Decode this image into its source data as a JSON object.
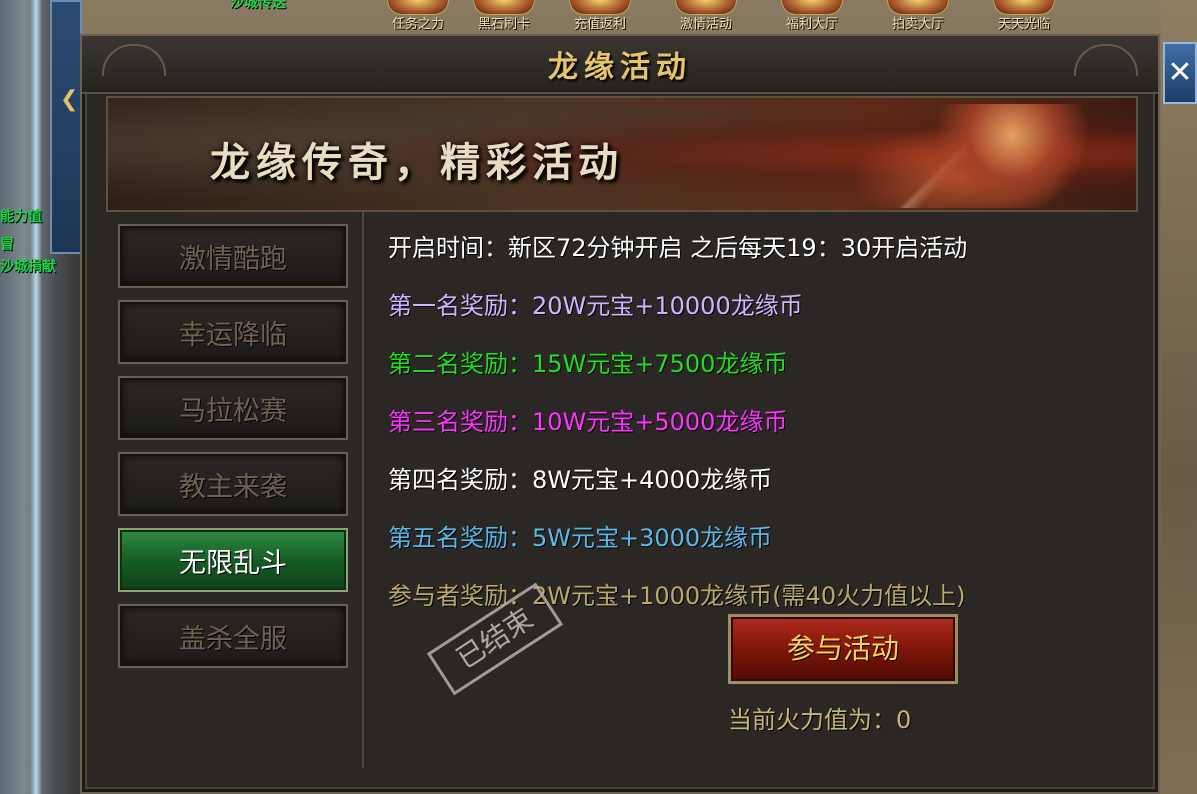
{
  "world": {
    "left_labels": [
      "能力值",
      "冒",
      "沙城捐献"
    ],
    "top_tag": "沙城传送"
  },
  "topbar": {
    "icons": [
      "任务之力",
      "黑石刷卡",
      "充值返利",
      "激情活动",
      "福利大厅",
      "拍卖大厅",
      "天天光临"
    ]
  },
  "dialog": {
    "title": "龙缘活动",
    "close_label": "✕",
    "banner_text": "龙缘传奇，精彩活动"
  },
  "tabs": [
    {
      "label": "激情酷跑",
      "active": false
    },
    {
      "label": "幸运降临",
      "active": false
    },
    {
      "label": "马拉松赛",
      "active": false
    },
    {
      "label": "教主来袭",
      "active": false
    },
    {
      "label": "无限乱斗",
      "active": true
    },
    {
      "label": "盖杀全服",
      "active": false
    }
  ],
  "content": {
    "open_time": {
      "label": "开启时间：",
      "value": "新区72分钟开启  之后每天19：30开启活动",
      "color": "#ffffff"
    },
    "rewards": [
      {
        "label": "第一名奖励：",
        "value": "20W元宝+10000龙缘币",
        "color": "#c9b8ff"
      },
      {
        "label": "第二名奖励：",
        "value": "15W元宝+7500龙缘币",
        "color": "#22dd22"
      },
      {
        "label": "第三名奖励：",
        "value": "10W元宝+5000龙缘币",
        "color": "#ff33ff"
      },
      {
        "label": "第四名奖励：",
        "value": "8W元宝+4000龙缘币",
        "color": "#ffffff"
      },
      {
        "label": "第五名奖励：",
        "value": "5W元宝+3000龙缘币",
        "color": "#5ab8e6"
      },
      {
        "label": "参与者奖励：",
        "value": "2W元宝+1000龙缘币(需40火力值以上)",
        "color": "#b9a86a"
      }
    ],
    "stamp_text": "已结束",
    "join_button": "参与活动",
    "firepower_label": "当前火力值为：",
    "firepower_value": "0"
  }
}
